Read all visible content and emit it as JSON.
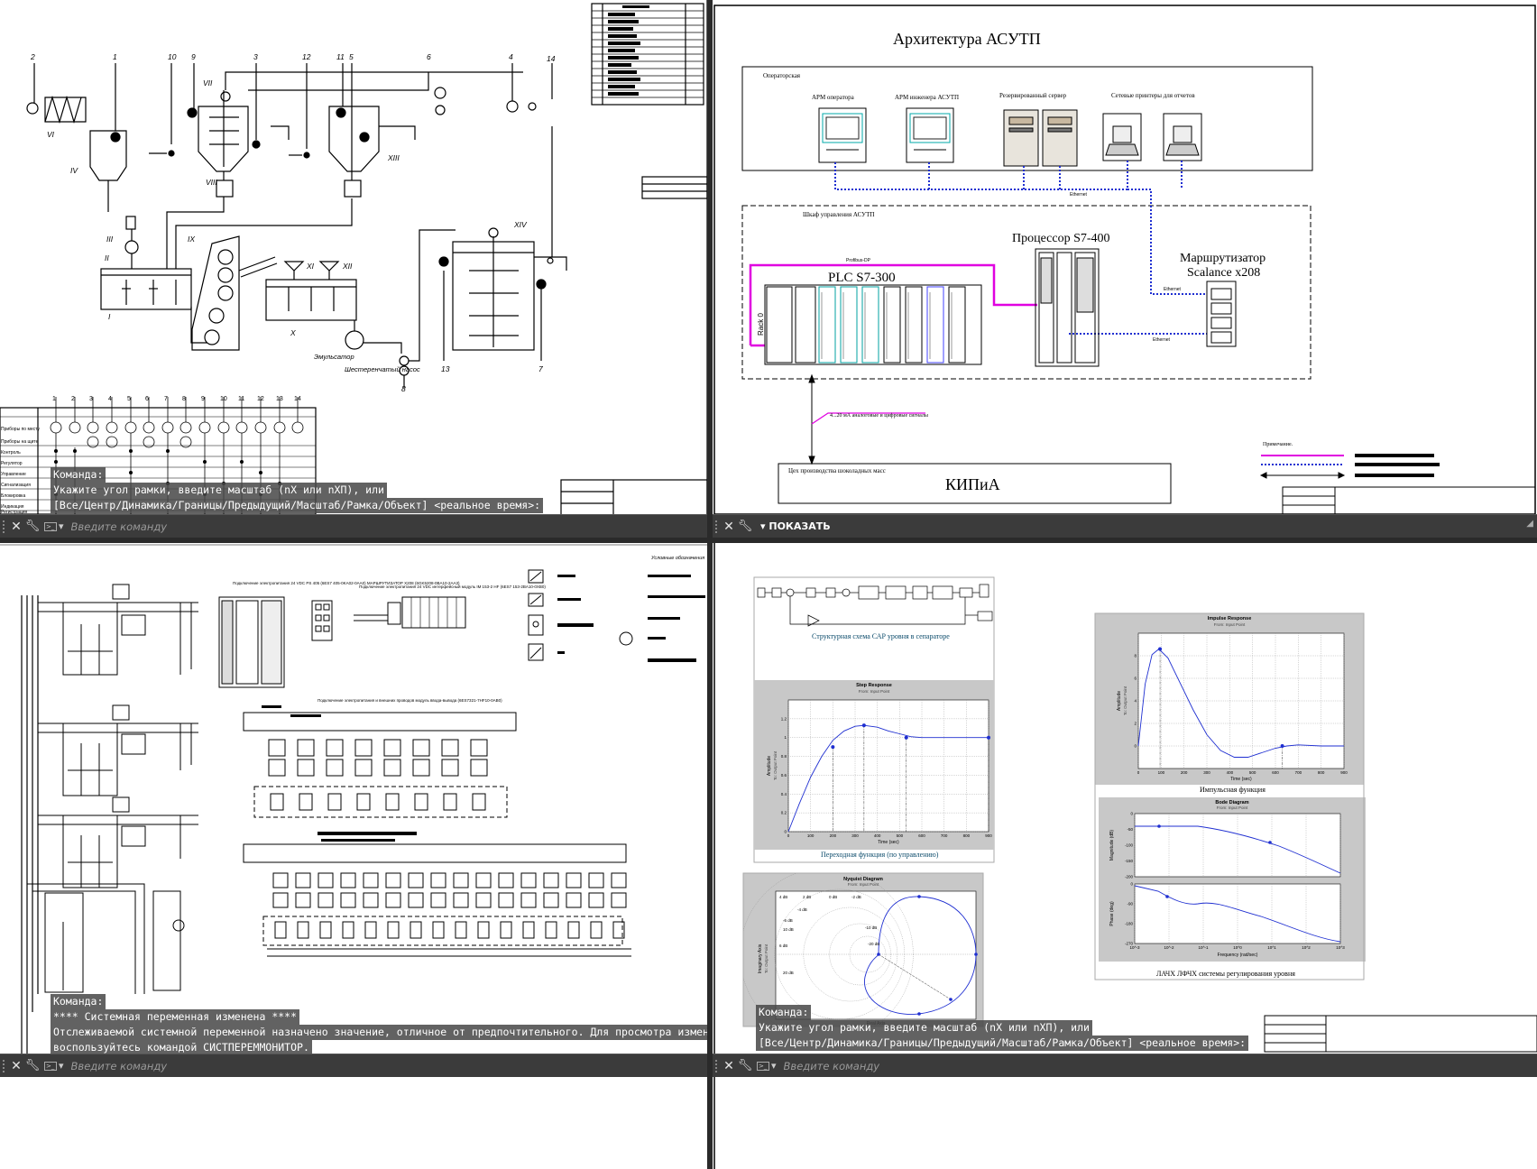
{
  "viewports": {
    "top_left": {
      "title": "",
      "history": [
        "Команда:",
        "Укажите угол рамки, введите масштаб (nX или nXП), или",
        "[Все/Центр/Динамика/Границы/Предыдущий/Масштаб/Рамка/Объект] <реальное время>:"
      ],
      "input_placeholder": "Введите команду",
      "equipment_labels": [
        "IV",
        "VI",
        "VII",
        "VIII",
        "IX",
        "X",
        "XI",
        "XII",
        "XIII",
        "XIV",
        "I",
        "II",
        "III"
      ],
      "annotations": {
        "emulsifier": "Эмульсатор",
        "gear_pump": "Шестеренчатый насос",
        "numbers": [
          "2",
          "1",
          "10",
          "9",
          "3",
          "12",
          "11",
          "5",
          "6",
          "4",
          "14",
          "13",
          "7",
          "8"
        ]
      },
      "sensor_table": {
        "columns": [
          "1",
          "2",
          "3",
          "4",
          "5",
          "6",
          "7",
          "8",
          "9",
          "10",
          "11",
          "12",
          "13",
          "14"
        ],
        "rows": [
          "Приборы по месту",
          "Приборы на щите",
          "Контроль",
          "Регулятор",
          "Управление",
          "Сигнализация",
          "Блокировка",
          "Индикация",
          "Регистрация"
        ]
      }
    },
    "top_right": {
      "title": "Архитектура АСУТП",
      "operator_room_label": "Операторская",
      "cabinet_label": "Шкаф управления АСУТП",
      "workstations": [
        "АРМ оператора",
        "АРМ инженера АСУТП",
        "Резервированный сервер",
        "Сетевые принтеры для отчетов"
      ],
      "plc_label": "PLC S7-300",
      "cpu_label": "Процессор S7-400",
      "router_label": "Маршрутизатор",
      "router_model": "Scalance x208",
      "ethernet": "Ethernet",
      "profibus": "Profibus-DP",
      "signals_label": "4...20 мА аналоговые и цифровые сигналы",
      "shop_label": "Цех производства шоколадных масс",
      "kip_label": "КИПиА",
      "rack_label": "Rack 0",
      "legend_label": "Примечание.",
      "show_button": "ПОКАЗАТЬ"
    },
    "bottom_left": {
      "history": [
        "Команда:",
        "**** Системная переменная изменена ****",
        "Отслеживаемой системной переменной назначено значение, отличное от предпочтительного. Для просмотра изменений",
        "воспользуйтесь командой СИСТПЕРЕММОНИТОР."
      ],
      "input_placeholder": "Введите команду",
      "legend_title": "Условные обозначения",
      "captions": [
        "Подключение электропитания 24 VDC PS 405 (6ES7 405-0KA02-0AA0) МАРШРУТИЗАТОР X208 (6GK5208-0BA10-2AA3)",
        "Подключение электропитания 24 VDC интерфейсный модуль IM 153-2 HF (6ES7 153-2BA10-0XB0)",
        "Подключение электропитания и внешних проводов модуль ввода-вывода (6ES7321-7HF10-0AB0)"
      ]
    },
    "bottom_right": {
      "history": [
        "Команда:",
        "Укажите угол рамки, введите масштаб (nX или nXП), или",
        "[Все/Центр/Динамика/Границы/Предыдущий/Масштаб/Рамка/Объект] <реальное время>:"
      ],
      "input_placeholder": "Введите команду",
      "simulink_caption": "Структурная схема САР уровня в сепараторе",
      "step": {
        "title": "Step Response",
        "subtitle": "From: Input Point",
        "xlabel": "Time (sec)",
        "ylabel": "Amplitude",
        "ylabel2": "To: Output Point",
        "caption": "Переходная функция (по управлению)"
      },
      "impulse": {
        "title": "Impulse Response",
        "subtitle": "From: Input Point",
        "xlabel": "Time (sec)",
        "ylabel": "Amplitude",
        "ylabel2": "To: Output Point",
        "caption": "Импульсная функция"
      },
      "nyquist": {
        "title": "Nyquist Diagram",
        "subtitle": "From: Input Point",
        "xlabel": "Real Axis",
        "ylabel": "Imaginary Axis",
        "ylabel2": "To: Output Point"
      },
      "bode": {
        "title": "Bode Diagram",
        "subtitle": "From: Input Point",
        "xlabel": "Frequency (rad/sec)",
        "ylabel_mag": "Magnitude (dB)",
        "ylabel_phase": "Phase (deg)",
        "caption": "ЛАЧХ ЛФЧХ системы регулирования уровня"
      }
    }
  },
  "chart_data": [
    {
      "type": "line",
      "title": "Step Response",
      "subtitle": "From: Input Point",
      "xlabel": "Time (sec)",
      "ylabel": "Amplitude",
      "xlim": [
        0,
        900
      ],
      "ylim": [
        0,
        1.4
      ],
      "x_ticks": [
        0,
        100,
        200,
        300,
        400,
        500,
        600,
        700,
        800,
        900
      ],
      "y_ticks": [
        0,
        0.2,
        0.4,
        0.6,
        0.8,
        1,
        1.2
      ],
      "series": [
        {
          "x": [
            0,
            50,
            100,
            150,
            200,
            250,
            300,
            340,
            400,
            450,
            500,
            550,
            600,
            700,
            800,
            900
          ],
          "y": [
            0,
            0.3,
            0.58,
            0.8,
            0.97,
            1.07,
            1.12,
            1.13,
            1.11,
            1.07,
            1.04,
            1.01,
            1.0,
            1.0,
            1.0,
            1.0
          ]
        }
      ],
      "markers": [
        {
          "x": 200,
          "y": 0.9
        },
        {
          "x": 340,
          "y": 1.13
        },
        {
          "x": 530,
          "y": 1.0
        },
        {
          "x": 900,
          "y": 1.0
        }
      ]
    },
    {
      "type": "line",
      "title": "Impulse Response",
      "subtitle": "From: Input Point",
      "xlabel": "Time (sec)",
      "ylabel": "Amplitude",
      "xlim": [
        0,
        900
      ],
      "ylim": [
        -2,
        10
      ],
      "x_ticks": [
        0,
        100,
        200,
        300,
        400,
        500,
        600,
        700,
        800,
        900
      ],
      "y_ticks": [
        0,
        2,
        4,
        6,
        8
      ],
      "series": [
        {
          "x": [
            0,
            30,
            60,
            90,
            130,
            180,
            240,
            300,
            360,
            420,
            480,
            540,
            600,
            650,
            700,
            800,
            900
          ],
          "y": [
            0,
            5.5,
            8.1,
            8.6,
            7.8,
            5.7,
            3.2,
            1.0,
            -0.4,
            -1.0,
            -1.0,
            -0.6,
            -0.2,
            0.0,
            0.1,
            0.0,
            0.0
          ]
        }
      ],
      "markers": [
        {
          "x": 95,
          "y": 8.6
        },
        {
          "x": 630,
          "y": 0.0
        }
      ]
    },
    {
      "type": "line",
      "title": "Nyquist Diagram",
      "subtitle": "From: Input Point",
      "xlabel": "Real Axis",
      "ylabel": "Imaginary Axis",
      "grid_labels": [
        "4 dB",
        "2 dB",
        "0 dB",
        "-2 dB",
        "-4 dB",
        "-6 dB",
        "10 dB",
        "6 dB",
        "20 dB",
        "-10 dB",
        "-20 dB"
      ]
    },
    {
      "type": "line",
      "title": "Bode Diagram",
      "subtitle": "From: Input Point",
      "xlabel": "Frequency (rad/sec)",
      "ylabel": "Magnitude (dB)",
      "mag_ticks": [
        0,
        -50,
        -100,
        -150,
        -200
      ],
      "phase_ticks": [
        0,
        -90,
        -180,
        -270
      ],
      "x_ticks": [
        "10^-3",
        "10^-2",
        "10^-1",
        "10^0",
        "10^1",
        "10^2",
        "10^3"
      ]
    }
  ]
}
